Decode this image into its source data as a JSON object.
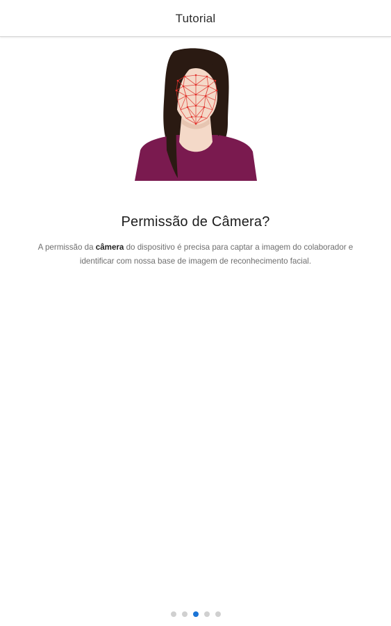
{
  "header": {
    "title": "Tutorial"
  },
  "illustration": {
    "icon": "face-recognition-illustration",
    "colors": {
      "hair": "#2a1a12",
      "skin": "#f4d9c8",
      "shirt": "#7a1a4f",
      "mesh": "#e0302a"
    }
  },
  "content": {
    "title": "Permissão de Câmera?",
    "description_before": "A permissão da ",
    "description_bold": "câmera",
    "description_after": " do dispositivo é precisa para captar a imagem do colaborador e identificar com nossa base de imagem de reconhecimento facial."
  },
  "pager": {
    "total_pages": 5,
    "current_page": 3,
    "active_color": "#1b74d6",
    "inactive_color": "#d0d0d0"
  }
}
